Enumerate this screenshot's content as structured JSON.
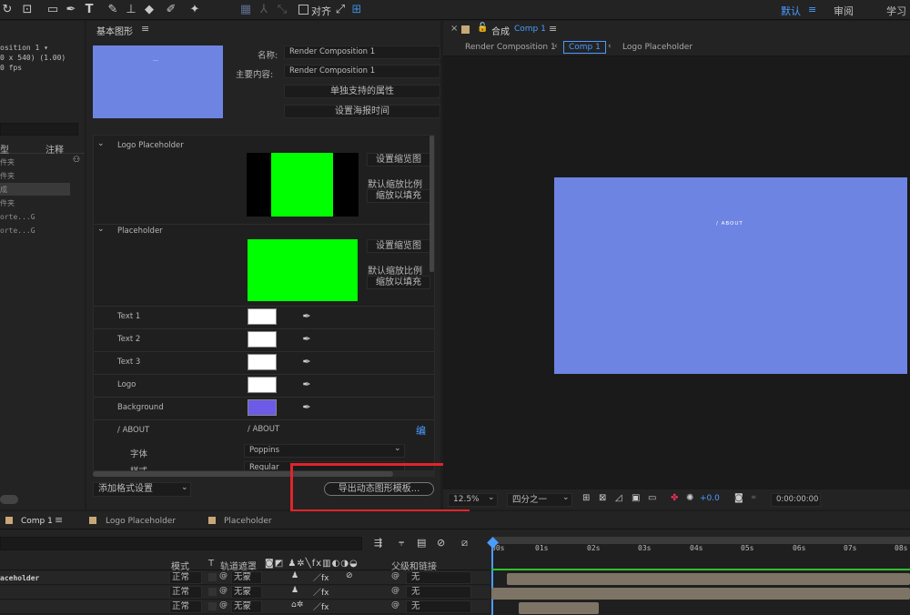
{
  "toolbar": {
    "align_label": "对齐",
    "workspaces": [
      "默认",
      "审阅",
      "学习"
    ],
    "workspace_menu_icon": "≡",
    "active_workspace_color": "#4a9cff"
  },
  "project_panel": {
    "comp_name": "osition 1 ▾",
    "comp_size": "0 x 540) (1.00)",
    "comp_fps": "0 fps",
    "col_type": "型",
    "col_comment": "注释",
    "items": [
      "件夹",
      "件夹",
      "成",
      "件夹",
      "orte...G",
      "orte...G"
    ]
  },
  "essential_graphics": {
    "title": "基本图形",
    "name_label": "名称:",
    "name_value": "Render Composition 1",
    "primary_label": "主要内容:",
    "primary_value": "Render Composition 1",
    "btn_solo": "单独支持的属性",
    "btn_poster": "设置海报时间",
    "thumb_label": "…",
    "groups": [
      {
        "name": "Logo Placeholder",
        "btn_thumb": "设置缩览图",
        "scale_label": "默认缩放比例",
        "scale_value": "缩放以填充"
      },
      {
        "name": "Placeholder",
        "btn_thumb": "设置缩览图",
        "scale_label": "默认缩放比例",
        "scale_value": "缩放以填充"
      }
    ],
    "colors": [
      {
        "label": "Text 1",
        "value": "#ffffff"
      },
      {
        "label": "Text 2",
        "value": "#ffffff"
      },
      {
        "label": "Text 3",
        "value": "#ffffff"
      },
      {
        "label": "Logo",
        "value": "#ffffff"
      },
      {
        "label": "Background",
        "value": "#6b5be6"
      }
    ],
    "about_label": "/ ABOUT",
    "about_value": "/ ABOUT",
    "edit_link": "编",
    "font_label": "字体",
    "font_value": "Poppins",
    "style_label": "样式",
    "style_value": "Regular",
    "add_format": "添加格式设置",
    "export_button": "导出动态图形模板...",
    "highlight_color": "#e0242b"
  },
  "composition_panel": {
    "title": "合成",
    "comp_link": "Comp 1",
    "breadcrumbs": [
      "Render Composition 1",
      "Comp 1",
      "Logo Placeholder"
    ],
    "canvas_text": "/ ABOUT",
    "canvas_color": "#6e84e2",
    "zoom": "12.5%",
    "resolution": "四分之一",
    "exposure": "+0.0",
    "timecode": "0:00:00:00"
  },
  "timeline": {
    "tabs": [
      "Comp 1",
      "Logo Placeholder",
      "Placeholder"
    ],
    "headers": {
      "mode": "模式",
      "t": "T",
      "track_matte": "轨道遮罩",
      "parent": "父级和链接"
    },
    "layer_name": "aceholder",
    "rows": [
      {
        "mode": "正常",
        "matte": "无蒙",
        "parent": "无"
      },
      {
        "mode": "正常",
        "matte": "无蒙",
        "parent": "无"
      },
      {
        "mode": "正常",
        "matte": "无蒙",
        "parent": "无"
      }
    ],
    "ruler": [
      "00s",
      "01s",
      "02s",
      "03s",
      "04s",
      "05s",
      "06s",
      "07s",
      "08s"
    ]
  }
}
